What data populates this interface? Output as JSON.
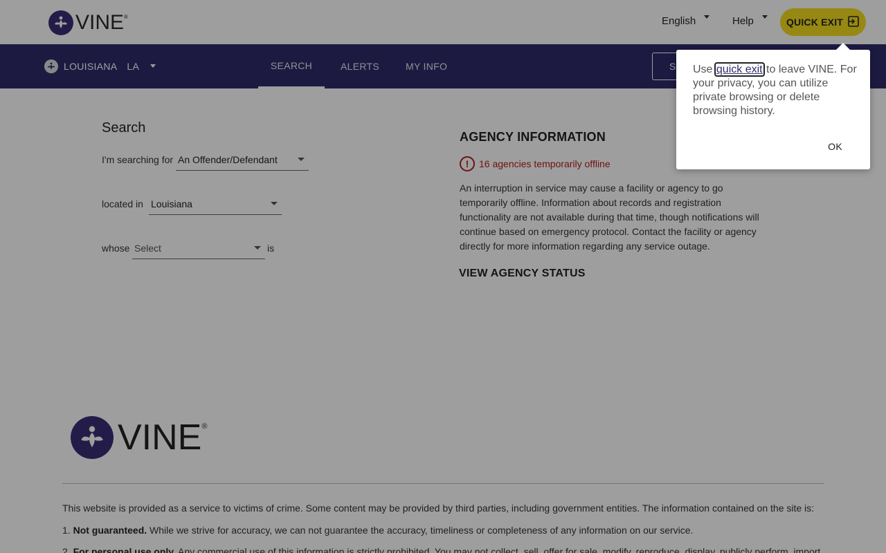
{
  "header": {
    "logo_text": "VINE",
    "logo_reg": "®",
    "language": "English",
    "help": "Help",
    "quick_exit": "QUICK EXIT"
  },
  "nav": {
    "state_name": "LOUISIANA",
    "state_abbr": "LA",
    "tabs": [
      {
        "label": "SEARCH",
        "active": true
      },
      {
        "label": "ALERTS",
        "active": false
      },
      {
        "label": "MY INFO",
        "active": false
      }
    ],
    "sign_button_partial": "S"
  },
  "search": {
    "title": "Search",
    "searching_for_label": "I'm searching for",
    "searching_for_value": "An Offender/Defendant",
    "located_in_label": "located in",
    "located_in_value": "Louisiana",
    "whose_label": "whose",
    "whose_placeholder": "Select",
    "is_label": "is"
  },
  "agency": {
    "title": "AGENCY INFORMATION",
    "offline_text": "16 agencies temporarily offline",
    "description": "An interruption in service may cause a facility or agency to go temporarily offline. Information about records and registration functionality are not available during that time, though notifications will continue based on emergency protocol. Contact the facility or agency directly for more information regarding any service outage.",
    "view_status": "VIEW AGENCY STATUS"
  },
  "footer": {
    "logo_text": "VINE",
    "logo_reg": "®",
    "intro": "This website is provided as a service to victims of crime. Some content may be provided by third parties, including government entities. The information contained on the site is:",
    "item1_bold": "Not guaranteed.",
    "item1_text": " While we strive for accuracy, we can not guarantee the accuracy, timeliness or completeness of any information on our service.",
    "item2_bold": "For personal use only.",
    "item2_text": " Any commercial use of this information is strictly prohibited. You may not collect, sell, offer for sale, modify, reproduce, display, publicly perform, import"
  },
  "popover": {
    "pre": "Use ",
    "link": "quick exit",
    "post": " to leave VINE. For your privacy, you can utilize private browsing or delete browsing history.",
    "ok": "OK"
  },
  "colors": {
    "navbar": "#2f2b6b",
    "quick_exit": "#f2db1e",
    "logo_purple": "#3b2e74",
    "alert_red": "#b51c1c"
  }
}
